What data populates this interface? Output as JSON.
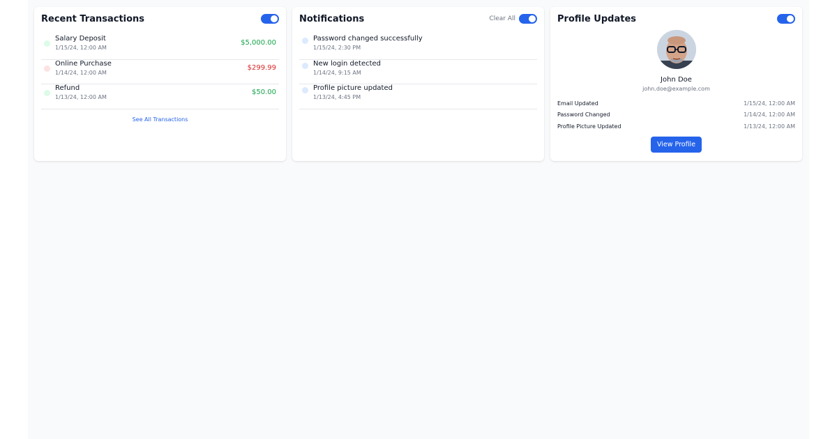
{
  "transactions": {
    "title": "Recent Transactions",
    "items": [
      {
        "title": "Salary Deposit",
        "time": "1/15/24, 12:00 AM",
        "amount": "$5,000.00",
        "kind": "pos"
      },
      {
        "title": "Online Purchase",
        "time": "1/14/24, 12:00 AM",
        "amount": "$299.99",
        "kind": "neg"
      },
      {
        "title": "Refund",
        "time": "1/13/24, 12:00 AM",
        "amount": "$50.00",
        "kind": "pos"
      }
    ],
    "see_all_label": "See All Transactions"
  },
  "notifications": {
    "title": "Notifications",
    "clear_all_label": "Clear All",
    "items": [
      {
        "title": "Password changed successfully",
        "time": "1/15/24, 2:30 PM"
      },
      {
        "title": "New login detected",
        "time": "1/14/24, 9:15 AM"
      },
      {
        "title": "Profile picture updated",
        "time": "1/13/24, 4:45 PM"
      }
    ]
  },
  "profile": {
    "title": "Profile Updates",
    "name": "John Doe",
    "email": "john.doe@example.com",
    "updates": [
      {
        "label": "Email Updated",
        "time": "1/15/24, 12:00 AM"
      },
      {
        "label": "Password Changed",
        "time": "1/14/24, 12:00 AM"
      },
      {
        "label": "Profile Picture Updated",
        "time": "1/13/24, 12:00 AM"
      }
    ],
    "view_button_label": "View Profile"
  },
  "colors": {
    "accent": "#2563eb",
    "positive": "#16a34a",
    "negative": "#dc2626",
    "page_background": "#f9fafb"
  },
  "icons": {
    "toggle": "toggle-switch-icon",
    "status_dot": "status-dot-icon"
  }
}
